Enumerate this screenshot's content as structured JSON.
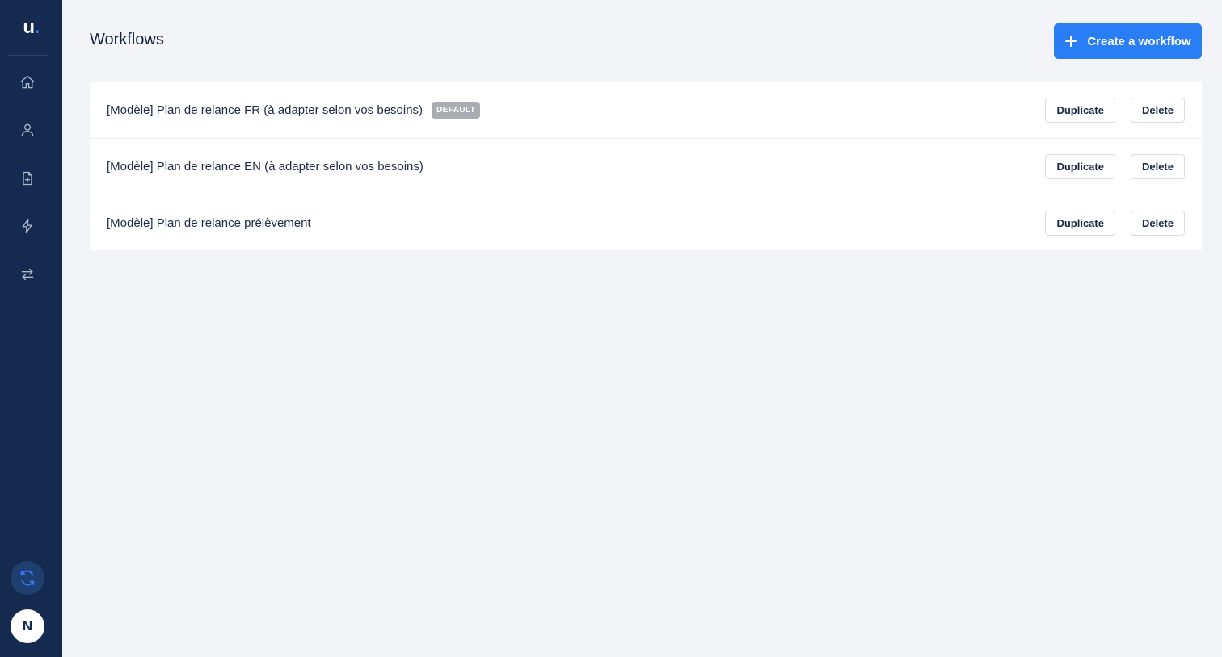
{
  "sidebar": {
    "logo_text": "u",
    "logo_dot": ".",
    "nav_items": [
      {
        "icon": "home-icon"
      },
      {
        "icon": "user-icon"
      },
      {
        "icon": "document-icon"
      },
      {
        "icon": "lightning-icon"
      },
      {
        "icon": "transfer-arrows-icon"
      }
    ],
    "sync_icon": "sync-icon",
    "avatar_initial": "N"
  },
  "header": {
    "title": "Workflows",
    "create_label": "Create a workflow"
  },
  "workflows": [
    {
      "title": "[Modèle] Plan de relance FR (à adapter selon vos besoins)",
      "badge": "DEFAULT",
      "duplicate_label": "Duplicate",
      "delete_label": "Delete"
    },
    {
      "title": "[Modèle] Plan de relance EN (à adapter selon vos besoins)",
      "badge": "",
      "duplicate_label": "Duplicate",
      "delete_label": "Delete"
    },
    {
      "title": "[Modèle] Plan de relance prélèvement",
      "badge": "",
      "duplicate_label": "Duplicate",
      "delete_label": "Delete"
    }
  ],
  "colors": {
    "sidebar_bg": "#142a4f",
    "accent": "#2a7ef5",
    "page_bg": "#f2f4f8",
    "badge_bg": "#a9adb3"
  }
}
